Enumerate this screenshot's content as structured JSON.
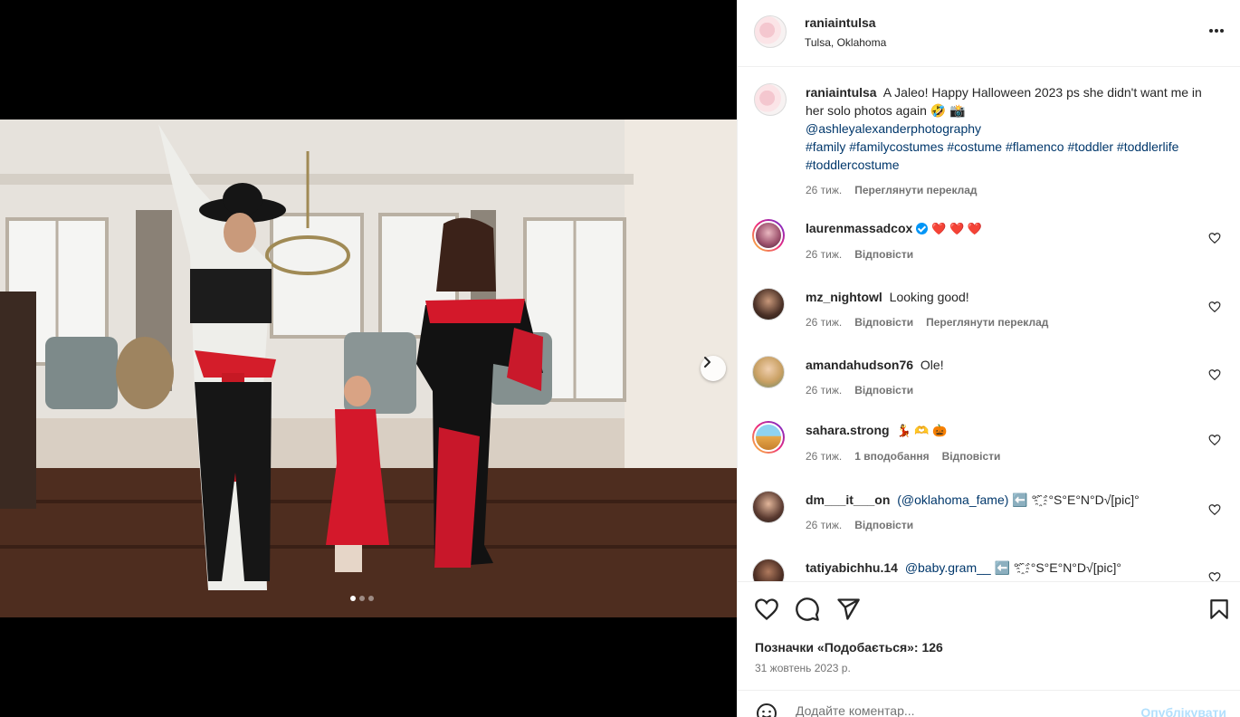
{
  "post": {
    "username": "raniaintulsa",
    "location": "Tulsa, Oklahoma",
    "caption": {
      "text": "A Jaleo! Happy Halloween 2023 ps she didn't want me in her solo photos again 🤣 📸",
      "mention": "@ashleyalexanderphotography",
      "hashtags": "#family #familycostumes #costume #flamenco #toddler #toddlerlife #toddlercostume",
      "time": "26 тиж.",
      "translate": "Переглянути переклад"
    },
    "likes_text": "Позначки «Подобається»: 126",
    "date": "31 жовтень 2023 р.",
    "carousel": {
      "current": 1,
      "total": 3
    }
  },
  "comments": [
    {
      "username": "laurenmassadcox",
      "verified": true,
      "text": "❤️ ❤️ ❤️",
      "time": "26 тиж.",
      "likes": "",
      "reply": "Відповісти",
      "translate": ""
    },
    {
      "username": "mz_nightowl",
      "text": "Looking good!",
      "time": "26 тиж.",
      "likes": "",
      "reply": "Відповісти",
      "translate": "Переглянути переклад"
    },
    {
      "username": "amandahudson76",
      "text": "Ole!",
      "time": "26 тиж.",
      "likes": "",
      "reply": "Відповісти",
      "translate": ""
    },
    {
      "username": "sahara.strong",
      "text": "💃 🫶 🎃",
      "time": "26 тиж.",
      "likes": "1 вподобання",
      "reply": "Відповісти",
      "translate": ""
    },
    {
      "username": "dm___it___on",
      "link": "(@oklahoma_fame)",
      "text": "⬅️ °`҈ `°S°E°N°D√[pic]°",
      "time": "26 тиж.",
      "likes": "",
      "reply": "Відповісти",
      "translate": ""
    },
    {
      "username": "tatiyabichhu.14",
      "link": "@baby.gram__",
      "text": "⬅️ °`҈ `°S°E°N°D√[pic]°",
      "time": "",
      "likes": "",
      "reply": "",
      "translate": ""
    }
  ],
  "add_comment": {
    "placeholder": "Додайте коментар...",
    "publish": "Опублікувати"
  },
  "icons": {
    "more": "more-horizontal-icon",
    "like": "heart-icon",
    "comment": "comment-icon",
    "share": "send-icon",
    "save": "bookmark-icon",
    "next": "chevron-right-icon",
    "emoji": "smiley-icon"
  },
  "colors": {
    "link": "#00376b",
    "publish_disabled": "#b2dffc",
    "verified": "#0095f6",
    "muted": "#737373"
  }
}
